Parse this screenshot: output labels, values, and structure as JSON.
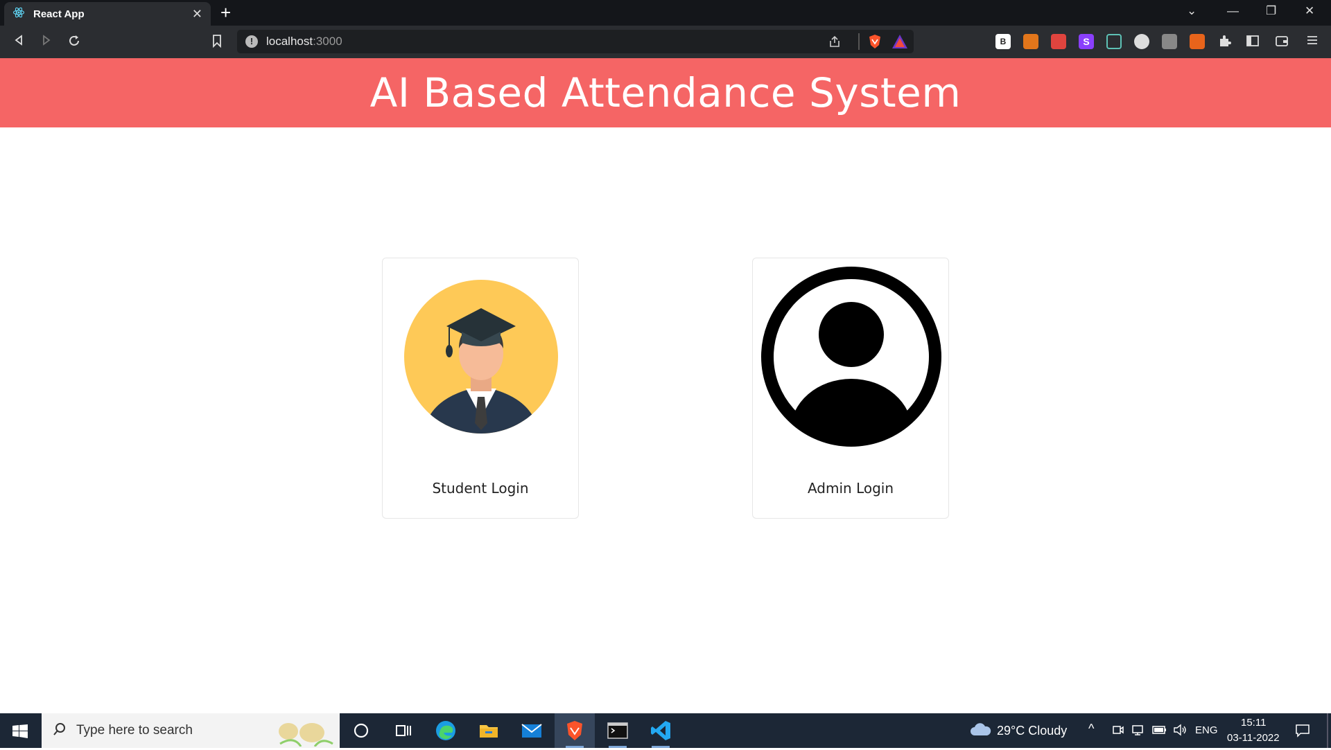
{
  "browser": {
    "tab_title": "React App",
    "tab_close": "✕",
    "new_tab": "+",
    "url_host": "localhost",
    "url_port": ":3000"
  },
  "page": {
    "title": "AI Based Attendance System",
    "cards": [
      {
        "label": "Student Login"
      },
      {
        "label": "Admin Login"
      }
    ]
  },
  "taskbar": {
    "search_placeholder": "Type here to search",
    "weather": "29°C  Cloudy",
    "language": "ENG",
    "time": "15:11",
    "date": "03-11-2022"
  },
  "colors": {
    "header_bg": "#f56565",
    "student_circle": "#fec957",
    "taskbar_bg": "#1c2736"
  }
}
